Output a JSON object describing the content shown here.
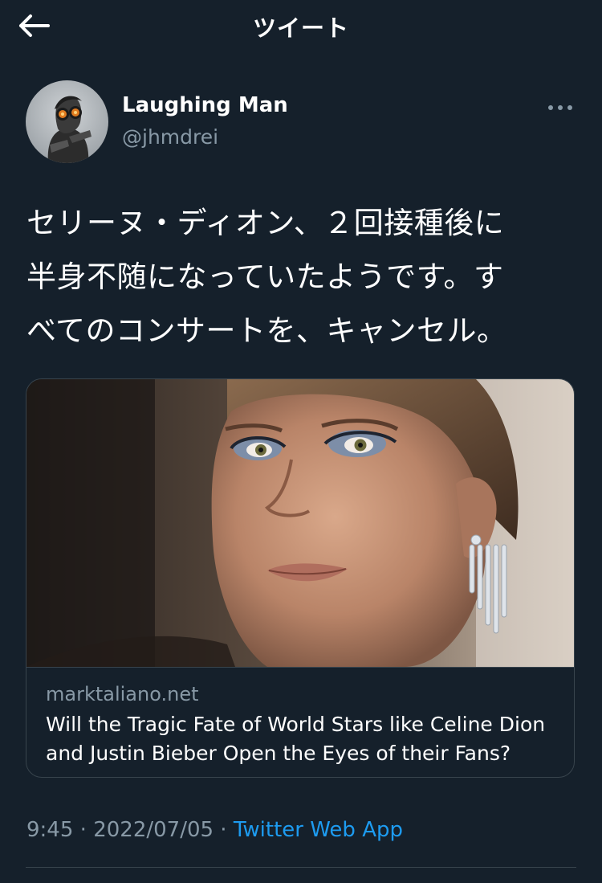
{
  "header": {
    "title": "ツイート",
    "back_icon": "arrow-left-icon"
  },
  "author": {
    "display_name": "Laughing Man",
    "handle": "@jhmdrei",
    "avatar_icon": "avatar-image",
    "more_icon": "more-horizontal-icon"
  },
  "tweet": {
    "line1": "セリーヌ・ディオン、２回接種後に",
    "line2": "半身不随になっていたようです。す",
    "line3": "べてのコンサートを、キャンセル。"
  },
  "card": {
    "image_icon": "article-photo",
    "domain": "marktaliano.net",
    "title": "Will the Tragic Fate of World Stars like Celine Dion and Justin Bieber Open the Eyes of their Fans?"
  },
  "meta": {
    "time": "9:45",
    "separator": " · ",
    "date": "2022/07/05",
    "app": "Twitter Web App"
  },
  "colors": {
    "background": "#15202b",
    "text_primary": "#ffffff",
    "text_secondary": "#8899a6",
    "accent": "#1d9bf0",
    "border": "#38444d"
  }
}
